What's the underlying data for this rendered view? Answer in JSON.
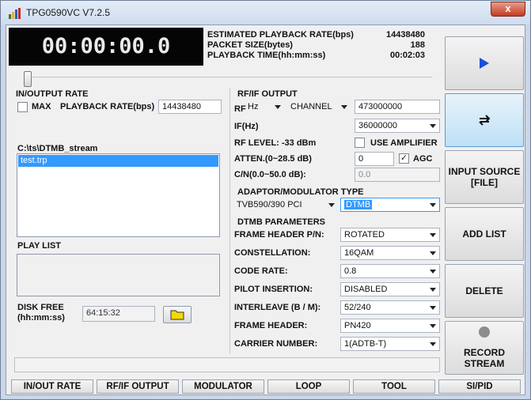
{
  "window": {
    "title": "TPG0590VC V7.2.5",
    "close_glyph": "x"
  },
  "display": {
    "time": "00:00:00.0"
  },
  "stats": {
    "playback_rate_label": "ESTIMATED PLAYBACK RATE(bps)",
    "playback_rate_value": "14438480",
    "packet_size_label": "PACKET SIZE(bytes)",
    "packet_size_value": "188",
    "playback_time_label": "PLAYBACK TIME(hh:mm:ss)",
    "playback_time_value": "00:02:03"
  },
  "progress": {
    "position": 0.0
  },
  "io_rate": {
    "heading": "IN/OUTPUT RATE",
    "max_label": "MAX",
    "max_checked": false,
    "rate_label": "PLAYBACK RATE(bps)",
    "rate_value": "14438480"
  },
  "file_list": {
    "path": "C:\\ts\\DTMB_stream",
    "items": [
      "test.trp"
    ],
    "selected": "test.trp"
  },
  "play_list": {
    "heading": "PLAY LIST"
  },
  "disk": {
    "label_line1": "DISK FREE",
    "label_line2": "(hh:mm:ss)",
    "value": "64:15:32"
  },
  "rf_output": {
    "heading": "RF/IF OUTPUT",
    "rf_label": "RF",
    "unit": "Hz",
    "mode": "CHANNEL",
    "frequency": "473000000",
    "if_label": "IF(Hz)",
    "if_value": "36000000",
    "rf_level": "RF LEVEL: -33 dBm",
    "use_amplifier_label": "USE AMPLIFIER",
    "use_amplifier_checked": false,
    "atten_label": "ATTEN.(0~28.5 dB)",
    "atten_value": "0",
    "agc_label": "AGC",
    "agc_checked": true,
    "cn_label": "C/N(0.0~50.0 dB):",
    "cn_value": "0.0"
  },
  "adaptor": {
    "heading": "ADAPTOR/MODULATOR TYPE",
    "adaptor_value": "TVB590/390 PCI",
    "modulator_value": "DTMB"
  },
  "dtmb": {
    "heading": "DTMB PARAMETERS",
    "params": [
      {
        "label": "FRAME HEADER P/N:",
        "value": "ROTATED"
      },
      {
        "label": "CONSTELLATION:",
        "value": "16QAM"
      },
      {
        "label": "CODE RATE:",
        "value": "0.8"
      },
      {
        "label": "PILOT INSERTION:",
        "value": "DISABLED"
      },
      {
        "label": "INTERLEAVE (B / M):",
        "value": "52/240"
      },
      {
        "label": "FRAME HEADER:",
        "value": "PN420"
      },
      {
        "label": "CARRIER NUMBER:",
        "value": "1(ADTB-T)"
      }
    ]
  },
  "side_buttons": {
    "input_source_line1": "INPUT SOURCE",
    "input_source_line2": "[FILE]",
    "add_list": "ADD LIST",
    "delete": "DELETE",
    "record_line1": "RECORD",
    "record_line2": "STREAM"
  },
  "tabs": [
    "IN/OUT RATE",
    "RF/IF OUTPUT",
    "MODULATOR",
    "LOOP",
    "TOOL",
    "SI/PID"
  ],
  "colors": {
    "play_icon": "#1c4fd6",
    "selection": "#3399ff",
    "record_dot": "#8c8c8c",
    "folder": "#f5d800"
  }
}
